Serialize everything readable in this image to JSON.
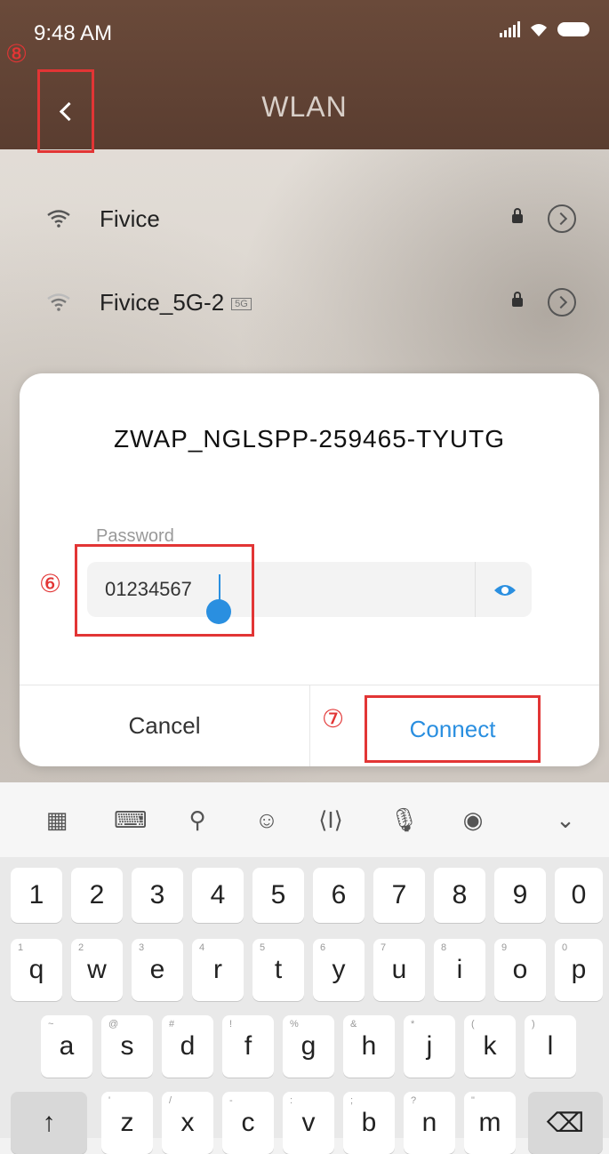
{
  "status_bar": {
    "time": "9:48 AM"
  },
  "header": {
    "title": "WLAN"
  },
  "annotations": {
    "back": "⑧",
    "password": "⑥",
    "connect": "⑦"
  },
  "networks": [
    {
      "name": "Fivice",
      "badge": ""
    },
    {
      "name": "Fivice_5G-2",
      "badge": "5G"
    }
  ],
  "dialog": {
    "ssid": "ZWAP_NGLSPP-259465-TYUTG",
    "password_label": "Password",
    "password_value": "01234567",
    "cancel_label": "Cancel",
    "connect_label": "Connect"
  },
  "keyboard": {
    "toolbar_icons": [
      "grid-icon",
      "keyboard-icon",
      "search-icon",
      "emoji-icon",
      "cursor-move-icon",
      "mic-icon",
      "bag-icon",
      "chevron-down-icon"
    ],
    "row_numbers": [
      "1",
      "2",
      "3",
      "4",
      "5",
      "6",
      "7",
      "8",
      "9",
      "0"
    ],
    "row_q": [
      "q",
      "w",
      "e",
      "r",
      "t",
      "y",
      "u",
      "i",
      "o",
      "p"
    ],
    "row_q_sub": [
      "1",
      "2",
      "3",
      "4",
      "5",
      "6",
      "7",
      "8",
      "9",
      "0"
    ],
    "row_a": [
      "a",
      "s",
      "d",
      "f",
      "g",
      "h",
      "j",
      "k",
      "l"
    ],
    "row_a_sub": [
      "~",
      "@",
      "#",
      "!",
      "%",
      "&",
      "*",
      "(",
      ")"
    ],
    "row_z": [
      "z",
      "x",
      "c",
      "v",
      "b",
      "n",
      "m"
    ],
    "row_z_sub": [
      "'",
      "/",
      "-",
      ":",
      ";",
      "?",
      "\""
    ],
    "shift": "↑",
    "backspace": "⌫"
  }
}
